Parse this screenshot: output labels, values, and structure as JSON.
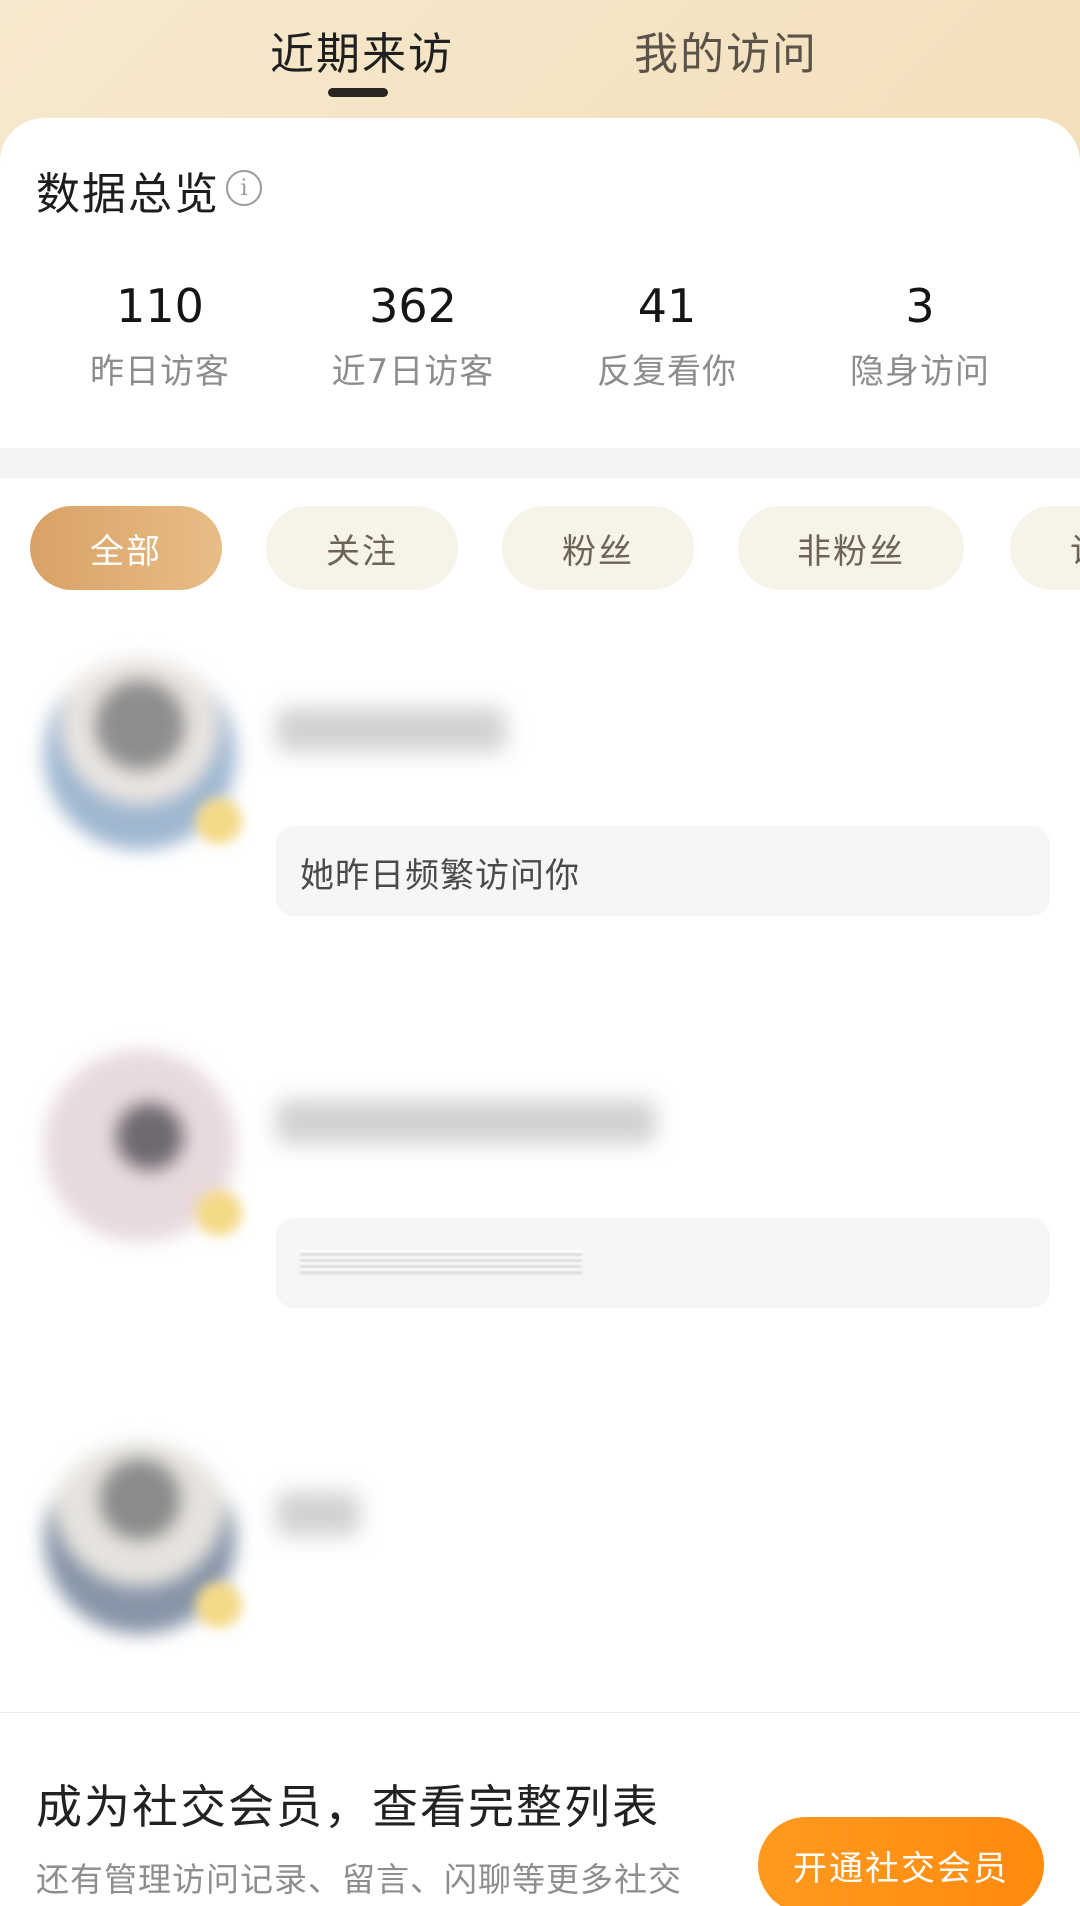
{
  "top_tabs": {
    "recent_visitors": "近期来访",
    "my_visits": "我的访问"
  },
  "overview": {
    "title": "数据总览",
    "info_icon": "info-circle-icon",
    "stats": [
      {
        "value": "110",
        "label": "昨日访客"
      },
      {
        "value": "362",
        "label": "近7日访客"
      },
      {
        "value": "41",
        "label": "反复看你"
      },
      {
        "value": "3",
        "label": "隐身访问"
      }
    ]
  },
  "filters": {
    "items": [
      "全部",
      "关注",
      "粉丝",
      "非粉丝",
      "访"
    ],
    "selected": "全部"
  },
  "visitors": [
    {
      "message": "她昨日频繁访问你"
    },
    {
      "message": ""
    },
    {
      "message": ""
    }
  ],
  "promo": {
    "title": "成为社交会员，查看完整列表",
    "subtitle": "还有管理访问记录、留言、闪聊等更多社交",
    "button_label": "开通社交会员"
  },
  "colors": {
    "header_gradient": [
      "#f7e9cf",
      "#e9c68f"
    ],
    "chip_active": "#d9a266",
    "chip_bg": "#f6f3e8",
    "cta": "#ff9a1f"
  }
}
